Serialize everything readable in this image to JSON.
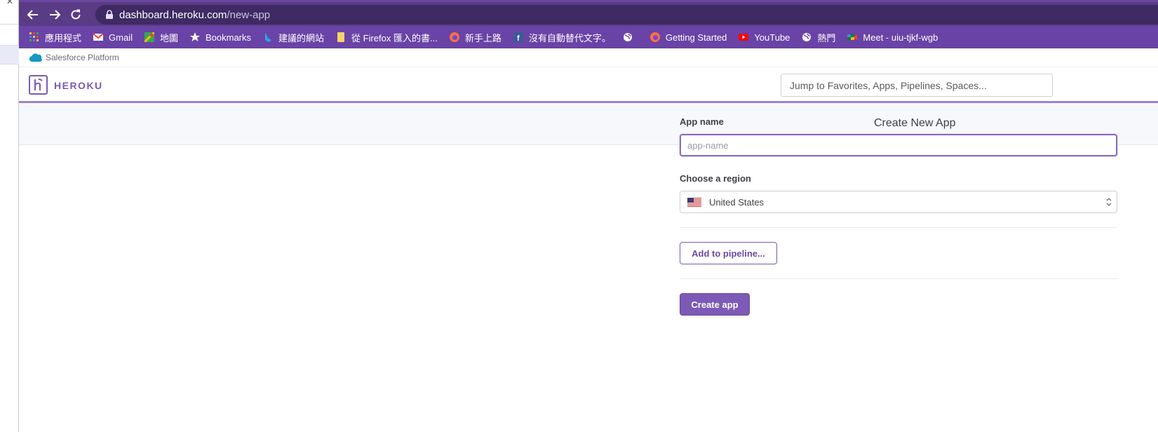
{
  "browser": {
    "url_host": "dashboard.heroku.com",
    "url_path": "/new-app",
    "bookmarks": [
      {
        "label": "應用程式",
        "icon": "apps-grid-icon"
      },
      {
        "label": "Gmail",
        "icon": "gmail-icon"
      },
      {
        "label": "地圖",
        "icon": "maps-icon"
      },
      {
        "label": "Bookmarks",
        "icon": "star-icon"
      },
      {
        "label": "建議的網站",
        "icon": "bing-icon"
      },
      {
        "label": "從 Firefox 匯入的書...",
        "icon": "folder-icon"
      },
      {
        "label": "新手上路",
        "icon": "firefox-icon"
      },
      {
        "label": "沒有自動替代文字。",
        "icon": "facebook-icon"
      },
      {
        "label": "",
        "icon": "globe-icon"
      },
      {
        "label": "Getting Started",
        "icon": "firefox-icon"
      },
      {
        "label": "YouTube",
        "icon": "youtube-icon"
      },
      {
        "label": "熱門",
        "icon": "globe-icon"
      },
      {
        "label": "Meet - uiu-tjkf-wgb",
        "icon": "meet-icon"
      }
    ]
  },
  "salesforce": {
    "label": "Salesforce Platform"
  },
  "header": {
    "logo_text": "HEROKU",
    "search_placeholder": "Jump to Favorites, Apps, Pipelines, Spaces..."
  },
  "subheader": {
    "title": "Create New App"
  },
  "form": {
    "app_name_label": "App name",
    "app_name_placeholder": "app-name",
    "app_name_value": "",
    "region_label": "Choose a region",
    "region_value": "United States",
    "pipeline_button": "Add to pipeline...",
    "create_button": "Create app"
  },
  "colors": {
    "browser_toolbar": "#5a3b86",
    "bookmarks_bar": "#6a43a6",
    "heroku_purple": "#7a5bb3",
    "create_button_bg": "#7c5ab5"
  }
}
